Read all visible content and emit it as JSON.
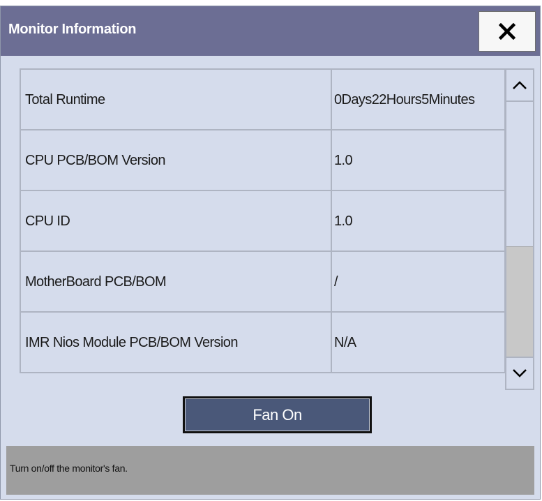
{
  "dialog": {
    "title": "Monitor Information",
    "close_icon": "close-x-icon"
  },
  "info_rows": [
    {
      "label": "Total Runtime",
      "value": "0Days22Hours5Minutes"
    },
    {
      "label": "CPU PCB/BOM Version",
      "value": "1.0"
    },
    {
      "label": "CPU ID",
      "value": "1.0"
    },
    {
      "label": "MotherBoard PCB/BOM",
      "value": "/"
    },
    {
      "label": "IMR Nios Module PCB/BOM Version",
      "value": "N/A"
    }
  ],
  "scrollbar": {
    "up_icon": "chevron-up-icon",
    "down_icon": "chevron-down-icon"
  },
  "fan_button": {
    "label": "Fan On"
  },
  "help": {
    "text": "Turn on/off the monitor's fan."
  },
  "colors": {
    "titlebar": "#6c6e94",
    "dialog_bg": "#d5dcec",
    "button_bg": "#4a5879",
    "help_bg": "#9e9e9e"
  }
}
